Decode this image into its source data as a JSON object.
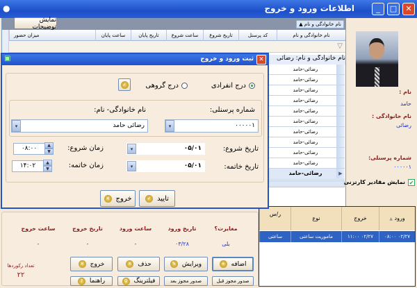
{
  "window": {
    "title": "اطلاعات ورود و خروج",
    "minimize": "_",
    "maximize": "□",
    "close": "✕"
  },
  "grid": {
    "show_descriptions_button": "نمایش توضیحات",
    "group_chip": "نام خانوادگی و نام",
    "columns": [
      "نام خانوادگی و نام",
      "کد پرسنل",
      "تاریخ شروع",
      "ساعت شروع",
      "تاریخ پایان",
      "ساعت پایان",
      "میزان حضور"
    ],
    "group_row": "نام خانوادگی و نام: رضائی",
    "rows": [
      "رضائی-حامد",
      "رضائی-حامد",
      "رضائی-حامد",
      "رضائی-حامد",
      "رضائی-حامد",
      "رضائی-حامد",
      "رضائی-حامد",
      "رضائی-حامد",
      "رضائی-حامد",
      "رضائی-حامد"
    ],
    "selected_row": "رضائی-حامد"
  },
  "profile": {
    "name_label": "نام :",
    "name": "حامد",
    "family_label": "نام خانوادگی :",
    "family": "رضائی",
    "personnel_label": "شماره پرسنلی:",
    "personnel": "۰۰۰۰۰۱",
    "show_cartesian": "نمایش مقادیر کارتزنی"
  },
  "dialog": {
    "title": "ثبت ورود و خروج",
    "single_insert": "درج انفرادی",
    "group_insert": "درج گروهی",
    "personnel_label": "شماره پرسنلی:",
    "personnel_value": "۰۰۰۰۰۱",
    "name_label": "نام خانوادگی- نام:",
    "name_value": "رضائی حامد",
    "start_date_label": "تاریخ شروع:",
    "start_date": "۰۵/۰۱",
    "end_date_label": "تاریخ خاتمه:",
    "end_date": "۰۵/۰۱",
    "start_time_label": "زمان شروع:",
    "start_time": "۰۸:۰۰",
    "end_time_label": "زمان خاتمه:",
    "end_time": "۱۴:۰۲",
    "ok": "تایید",
    "exit": "خروج"
  },
  "summary": {
    "labels": [
      "مغایرت؟",
      "تاریخ ورود",
      "ساعت ورود",
      "تاریخ خروج",
      "ساعت خروج"
    ],
    "values": [
      "بلی",
      "۰۳/۲۸",
      "-",
      "-",
      "-"
    ],
    "record_count_label": "تعداد رکوردها",
    "record_count": "۲۲"
  },
  "buttons": {
    "add": "اضافه",
    "edit": "ویرایش",
    "delete": "حذف",
    "exit": "خروج",
    "permit_before": "صدور مجوز قبل",
    "permit_after": "صدور مجوز بعد",
    "filtering": "فیلترینگ",
    "help": "راهنما"
  },
  "table": {
    "headers": [
      "ورود",
      "خروج",
      "نوع",
      "ر/س"
    ],
    "row": [
      "۰۲/۲۷ ۰۸:۰۰",
      "۰۲/۲۷ ۱۱:۰۰",
      "ماموریت ساعتی",
      "ساعتی"
    ]
  }
}
